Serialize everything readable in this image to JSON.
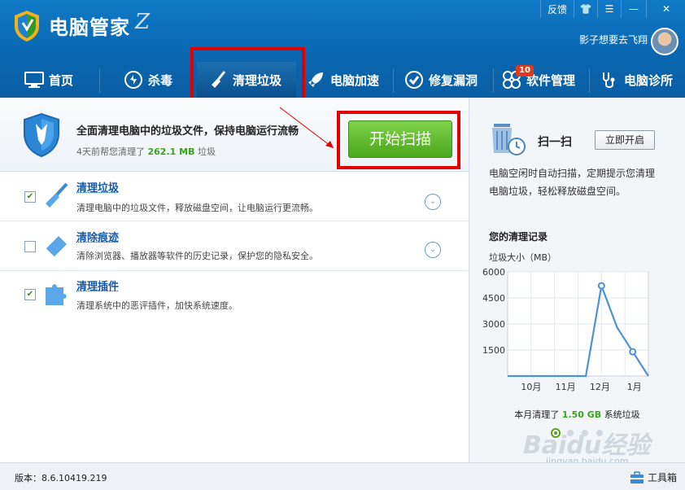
{
  "app": {
    "title": "电脑管家",
    "title_mark": "Z",
    "username": "影子想要去飞翔"
  },
  "window_controls": {
    "feedback": "反馈",
    "skin": "👕",
    "menu": "☰",
    "minimize": "—",
    "close": "✕"
  },
  "nav": {
    "tabs": [
      {
        "label": "首页",
        "icon": "monitor-icon"
      },
      {
        "label": "杀毒",
        "icon": "antivirus-icon"
      },
      {
        "label": "清理垃圾",
        "icon": "broom-icon",
        "active": true
      },
      {
        "label": "电脑加速",
        "icon": "rocket-icon"
      },
      {
        "label": "修复漏洞",
        "icon": "patch-icon"
      },
      {
        "label": "软件管理",
        "icon": "software-icon",
        "badge": "10"
      },
      {
        "label": "电脑诊所",
        "icon": "stethoscope-icon"
      }
    ]
  },
  "scan": {
    "title": "全面清理电脑中的垃圾文件，保持电脑运行流畅",
    "sub_prefix": "4天前帮您清理了",
    "sub_amount": "262.1 MB",
    "sub_suffix": "垃圾",
    "start_button": "开始扫描"
  },
  "options": [
    {
      "title": "清理垃圾",
      "desc": "清理电脑中的垃圾文件，释放磁盘空间，让电脑运行更流畅。",
      "checked": true,
      "icon": "broom-icon"
    },
    {
      "title": "清除痕迹",
      "desc": "清除浏览器、播放器等软件的历史记录，保护您的隐私安全。",
      "checked": false,
      "icon": "eraser-icon"
    },
    {
      "title": "清理插件",
      "desc": "清理系统中的恶评插件，加快系统速度。",
      "checked": true,
      "icon": "puzzle-icon"
    }
  ],
  "right": {
    "sweep_title": "扫一扫",
    "open_button": "立即开启",
    "description": "电脑空闲时自动扫描，定期提示您清理电脑垃圾，轻松释放磁盘空间。",
    "record_title": "您的清理记录",
    "unit_label": "垃圾大小（MB）",
    "summary_prefix": "本月清理了",
    "summary_amount": "1.50 GB",
    "summary_suffix": "系统垃圾"
  },
  "chart_data": {
    "type": "line",
    "categories": [
      "10月",
      "11月",
      "12月",
      "1月"
    ],
    "x": [
      0,
      1,
      2,
      3,
      4,
      5,
      6,
      7,
      8,
      9
    ],
    "values": [
      0,
      0,
      0,
      0,
      0,
      0,
      5200,
      2800,
      1400,
      0
    ],
    "markers": [
      6,
      8
    ],
    "yticks": [
      1500,
      3000,
      4500,
      6000
    ],
    "ylim": [
      0,
      6000
    ],
    "color": "#4b93d6"
  },
  "watermark": {
    "brand": "Baidu经验",
    "url": "jingyan.baidu.com"
  },
  "footer": {
    "version": "版本：8.6.10419.219",
    "toolbox": "工具箱"
  },
  "colors": {
    "header": "#0a67b0",
    "accent_green": "#4aa71c",
    "highlight_red": "#e00000"
  }
}
